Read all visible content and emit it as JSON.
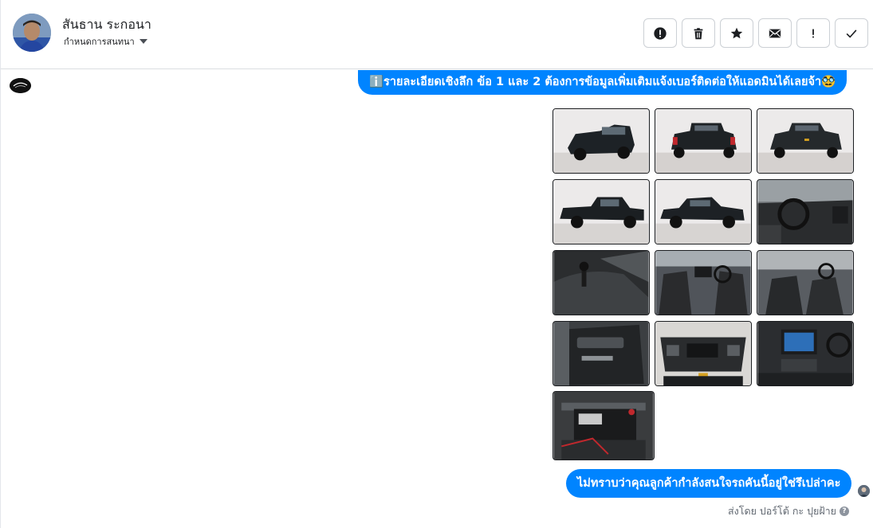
{
  "header": {
    "contact_name": "สันธาน ระกอนา",
    "stage_label": "กำหนดการสนทนา",
    "actions": [
      {
        "name": "report-spam",
        "icon": "alert-circle-icon"
      },
      {
        "name": "delete",
        "icon": "trash-icon"
      },
      {
        "name": "star",
        "icon": "star-icon"
      },
      {
        "name": "mark-unread",
        "icon": "envelope-icon"
      },
      {
        "name": "important",
        "icon": "exclamation-icon"
      },
      {
        "name": "mark-done",
        "icon": "checkmark-icon"
      }
    ]
  },
  "messages": {
    "first_bubble": "ℹ️รายละเอียดเชิงลึก ข้อ 1 และ 2 ต้องการข้อมูลเพิ่มเติมแจ้งเบอร์ติดต่อให้แอดมินได้เลยจ้า🥸",
    "gallery": [
      {
        "icon": "truck-front-photo"
      },
      {
        "icon": "truck-rear-photo"
      },
      {
        "icon": "truck-rear-quarter-photo"
      },
      {
        "icon": "truck-side-photo"
      },
      {
        "icon": "truck-side-front-photo"
      },
      {
        "icon": "dashboard-photo"
      },
      {
        "icon": "gear-shift-photo"
      },
      {
        "icon": "front-seats-photo"
      },
      {
        "icon": "seats-interior-photo"
      },
      {
        "icon": "door-panel-photo"
      },
      {
        "icon": "engine-bay-photo"
      },
      {
        "icon": "infotainment-photo"
      },
      {
        "icon": "battery-photo"
      }
    ],
    "second_bubble": "ไม่ทราบว่าคุณลูกค้ากำลังสนใจรถคันนี้อยู่ใช่รึเปล่าคะ",
    "sent_by": "ส่งโดย ปอร์โต้ กะ ปุยฝ้าย",
    "help_glyph": "?"
  },
  "colors": {
    "bubble": "#0084ff",
    "border": "#ccd0d5"
  }
}
